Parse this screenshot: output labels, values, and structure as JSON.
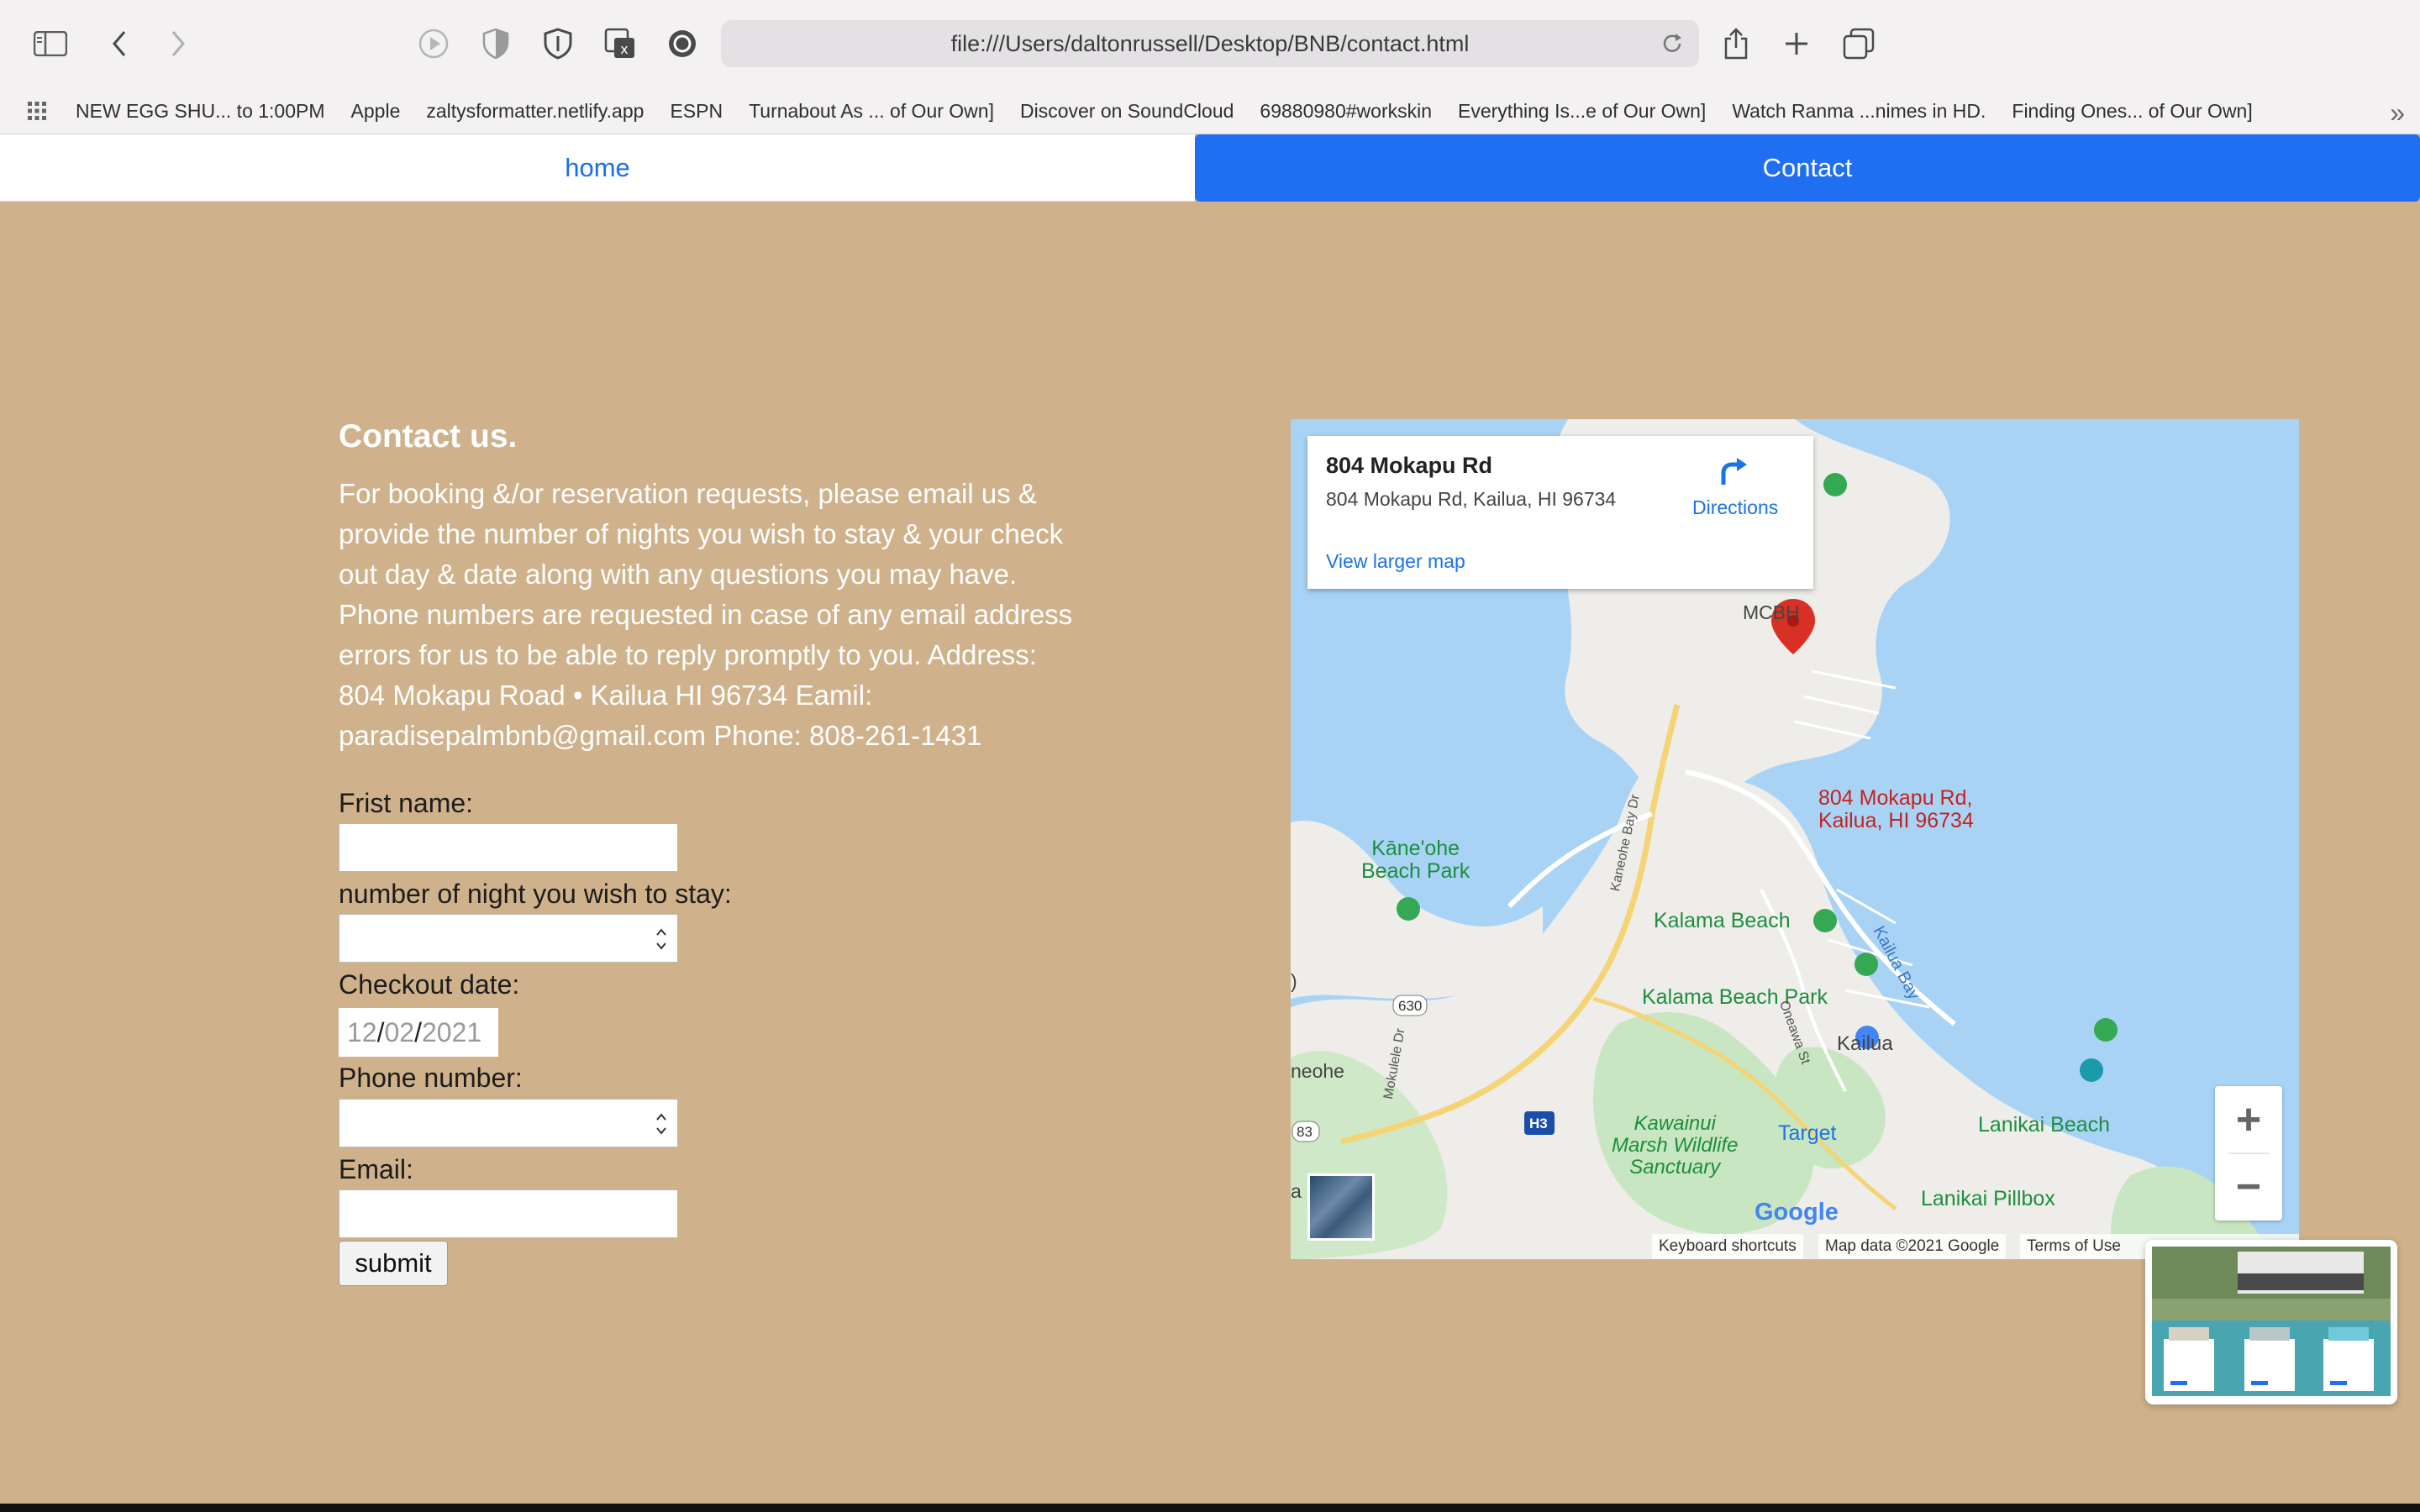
{
  "browser": {
    "url": "file:///Users/daltonrussell/Desktop/BNB/contact.html",
    "bookmarks": [
      "NEW EGG SHU... to 1:00PM",
      "Apple",
      "zaltysformatter.netlify.app",
      "ESPN",
      "Turnabout As ... of Our Own]",
      "Discover on SoundCloud",
      "69880980#workskin",
      "Everything Is...e of Our Own]",
      "Watch Ranma ...nimes in HD.",
      "Finding Ones... of Our Own]"
    ],
    "more_bookmarks": "»"
  },
  "nav": {
    "home_label": "home",
    "contact_label": "Contact"
  },
  "contact": {
    "title": "Contact us.",
    "body": "For booking &/or reservation requests, please email us & provide the number of nights you wish to stay & your check out day & date along with any questions you may have. Phone numbers are requested in case of any email address errors for us to be able to reply promptly to you. Address: 804 Mokapu Road • Kailua HI 96734 Eamil: paradisepalmbnb@gmail.com Phone: 808-261-1431"
  },
  "form": {
    "first_name_label": "Frist name:",
    "first_name_value": "",
    "nights_label": "number of night you wish to stay:",
    "nights_value": "",
    "checkout_label": "Checkout date:",
    "checkout_month": "12",
    "checkout_day": "02",
    "checkout_year": "2021",
    "phone_label": "Phone number:",
    "phone_value": "",
    "email_label": "Email:",
    "email_value": "",
    "submit_label": "submit"
  },
  "map": {
    "place_name": "804 Mokapu Rd",
    "place_address": "804 Mokapu Rd, Kailua, HI 96734",
    "directions_label": "Directions",
    "larger_map_label": "View larger map",
    "pin_label_line1": "804 Mokapu Rd,",
    "pin_label_line2": "Kailua, HI 96734",
    "labels": {
      "mcbh": "MCBH",
      "kaneohe_beach_park_1": "Kāne'ohe",
      "kaneohe_beach_park_2": "Beach Park",
      "kalama_beach": "Kalama Beach",
      "kalama_beach_park": "Kalama Beach Park",
      "kailua": "Kailua",
      "kailua_bay": "Kailua Bay",
      "kawainui_1": "Kawainui",
      "kawainui_2": "Marsh Wildlife",
      "kawainui_3": "Sanctuary",
      "target": "Target",
      "lanikai_beach": "Lanikai Beach",
      "lanikai_pillbox": "Lanikai Pillbox",
      "neohe": "neohe",
      "kaneohe_bay_dr": "Kaneohe Bay Dr",
      "mokulele_dr": "Mokulele Dr",
      "oneawa_st": "Oneawa St",
      "route_630": "630",
      "route_83": "83",
      "route_h3": "H3",
      "left_edge_a": "a",
      "left_edge_paren": ")"
    },
    "google_logo": "Google",
    "keyboard_shortcuts": "Keyboard shortcuts",
    "map_data": "Map data ©2021 Google",
    "terms": "Terms of Use",
    "zoom_in": "+",
    "zoom_out": "−"
  },
  "colors": {
    "page_bg": "#cfb28b",
    "nav_active": "#1f6ff0",
    "link_blue": "#1a73e8",
    "water": "#a9d3f5",
    "land": "#f1f0ed",
    "park_green": "#c7e6c1",
    "pin_red": "#d93025"
  }
}
